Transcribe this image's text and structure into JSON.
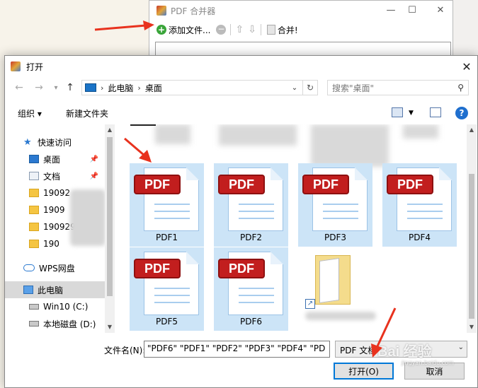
{
  "merger_window": {
    "title": "PDF 合并器",
    "add_files_label": "添加文件...",
    "merge_label": "合并!",
    "minimize": "—",
    "maximize": "☐",
    "close": "✕"
  },
  "dialog": {
    "title": "打开",
    "close": "✕",
    "breadcrumb": [
      "此电脑",
      "桌面"
    ],
    "search_placeholder": "搜索\"桌面\"",
    "organize_label": "组织 ▾",
    "new_folder_label": "新建文件夹",
    "help_label": "?"
  },
  "sidebar": {
    "items": [
      {
        "label": "快速访问",
        "icon": "star-icon"
      },
      {
        "label": "桌面",
        "icon": "desktop-icon",
        "pinned": true
      },
      {
        "label": "文档",
        "icon": "document-icon",
        "pinned": true
      },
      {
        "label": "19092",
        "icon": "folder-icon"
      },
      {
        "label": "1909",
        "icon": "folder-icon"
      },
      {
        "label": "190929w",
        "icon": "folder-icon"
      },
      {
        "label": "190",
        "icon": "folder-icon"
      },
      {
        "label": "WPS网盘",
        "icon": "cloud-icon"
      },
      {
        "label": "此电脑",
        "icon": "computer-icon",
        "selected": true
      },
      {
        "label": "Win10 (C:)",
        "icon": "drive-icon"
      },
      {
        "label": "本地磁盘 (D:)",
        "icon": "drive-icon"
      }
    ]
  },
  "files": {
    "top_partial_text": "190929邮件",
    "items": [
      {
        "name": "PDF1",
        "badge": "PDF",
        "selected": true
      },
      {
        "name": "PDF2",
        "badge": "PDF",
        "selected": true
      },
      {
        "name": "PDF3",
        "badge": "PDF",
        "selected": true
      },
      {
        "name": "PDF4",
        "badge": "PDF",
        "selected": true
      },
      {
        "name": "PDF5",
        "badge": "PDF",
        "selected": true
      },
      {
        "name": "PDF6",
        "badge": "PDF",
        "selected": true
      }
    ]
  },
  "footer": {
    "filename_label": "文件名(N):",
    "filename_value": "\"PDF6\" \"PDF1\" \"PDF2\" \"PDF3\" \"PDF4\" \"PD",
    "filetype_value": "PDF 文档",
    "open_label": "打开(O)",
    "cancel_label": "取消"
  },
  "watermark": {
    "text": "Bai 经验",
    "sub": "jingyan.baidu.com"
  },
  "colors": {
    "selection": "#cce4f7",
    "pdf_badge": "#c21e1e",
    "accent": "#0078d7",
    "arrow": "#e8321e"
  }
}
